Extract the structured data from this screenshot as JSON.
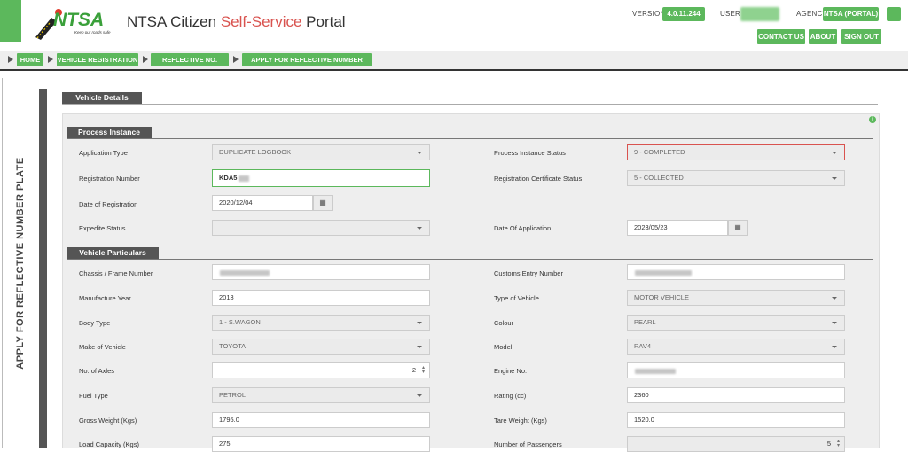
{
  "header": {
    "logo_text": "NTSA",
    "logo_tagline": "Keep our roads safe",
    "title_main": "NTSA Citizen ",
    "title_accent": "Self-Service",
    "title_end": " Portal",
    "version_label": "VERSION",
    "version_value": "4.0.11.244",
    "user_label": "USER",
    "agency_label": "AGENCY",
    "agency_value": "NTSA (PORTAL)",
    "buttons": {
      "contact": "CONTACT US",
      "about": "ABOUT",
      "signout": "SIGN OUT"
    }
  },
  "breadcrumb": [
    "HOME",
    "VEHICLE REGISTRATION",
    "REFLECTIVE NO. PLATE",
    "APPLY FOR REFLECTIVE NUMBER PLATE"
  ],
  "page_title": "APPLY FOR REFLECTIVE NUMBER PLATE",
  "tabs": {
    "vehicle_details": "Vehicle Details"
  },
  "sections": {
    "process_instance": "Process Instance",
    "vehicle_particulars": "Vehicle Particulars"
  },
  "process": {
    "application_type": {
      "label": "Application Type",
      "value": "DUPLICATE LOGBOOK"
    },
    "process_status": {
      "label": "Process Instance Status",
      "value": "9 - COMPLETED"
    },
    "registration_number": {
      "label": "Registration Number",
      "value": "KDA5"
    },
    "reg_cert_status": {
      "label": "Registration Certificate Status",
      "value": "5 - COLLECTED"
    },
    "date_of_registration": {
      "label": "Date of Registration",
      "value": "2020/12/04"
    },
    "expedite_status": {
      "label": "Expedite Status",
      "value": ""
    },
    "date_of_application": {
      "label": "Date Of Application",
      "value": "2023/05/23"
    }
  },
  "particulars": {
    "chassis": {
      "label": "Chassis / Frame Number"
    },
    "customs_entry": {
      "label": "Customs Entry Number"
    },
    "manufacture_year": {
      "label": "Manufacture Year",
      "value": "2013"
    },
    "type_of_vehicle": {
      "label": "Type of Vehicle",
      "value": "MOTOR VEHICLE"
    },
    "body_type": {
      "label": "Body Type",
      "value": "1 - S.WAGON"
    },
    "colour": {
      "label": "Colour",
      "value": "PEARL"
    },
    "make": {
      "label": "Make of Vehicle",
      "value": "TOYOTA"
    },
    "model": {
      "label": "Model",
      "value": "RAV4"
    },
    "axles": {
      "label": "No. of Axles",
      "value": "2"
    },
    "engine_no": {
      "label": "Engine No."
    },
    "fuel_type": {
      "label": "Fuel Type",
      "value": "PETROL"
    },
    "rating": {
      "label": "Rating (cc)",
      "value": "2360"
    },
    "gross_weight": {
      "label": "Gross Weight (Kgs)",
      "value": "1795.0"
    },
    "tare_weight": {
      "label": "Tare Weight (Kgs)",
      "value": "1520.0"
    },
    "load_capacity": {
      "label": "Load Capacity (Kgs)",
      "value": "275"
    },
    "passengers": {
      "label": "Number of Passengers",
      "value": "5"
    }
  },
  "colors": {
    "accent": "#5cb85c",
    "danger": "#d9534f",
    "dark": "#555555"
  }
}
